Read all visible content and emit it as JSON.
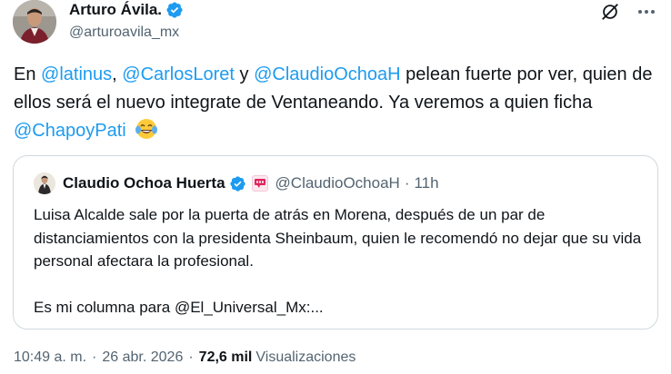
{
  "author": {
    "display_name": "Arturo Ávila.",
    "handle": "@arturoavila_mx"
  },
  "tweet": {
    "segments": [
      {
        "type": "text",
        "value": "En "
      },
      {
        "type": "mention",
        "value": "@latinus"
      },
      {
        "type": "text",
        "value": ", "
      },
      {
        "type": "mention",
        "value": "@CarlosLoret"
      },
      {
        "type": "text",
        "value": " y "
      },
      {
        "type": "mention",
        "value": "@ClaudioOchoaH"
      },
      {
        "type": "text",
        "value": " pelean fuerte por ver, quien de ellos será el nuevo integrate de Ventaneando. Ya veremos a quien ficha "
      },
      {
        "type": "mention",
        "value": "@ChapoyPati"
      },
      {
        "type": "text",
        "value": " "
      }
    ],
    "emoji_icon": "joy-emoji-icon"
  },
  "quote": {
    "display_name": "Claudio Ochoa Huerta",
    "handle": "@ClaudioOchoaH",
    "time": "11h",
    "paragraph1": "Luisa Alcalde sale por la puerta de atrás en Morena, después de un par de distanciamientos con la presidenta Sheinbaum, quien le recomendó no dejar que su vida personal afectara la profesional.",
    "paragraph2": "Es mi columna para @El_Universal_Mx:..."
  },
  "meta": {
    "time": "10:49 a. m.",
    "date": "26 abr. 2026",
    "views_count": "72,6 mil",
    "views_label": "Visualizaciones"
  },
  "colors": {
    "accent": "#1d9bf0",
    "text": "#0f1419",
    "secondary": "#536471",
    "border": "#cfd9de"
  }
}
